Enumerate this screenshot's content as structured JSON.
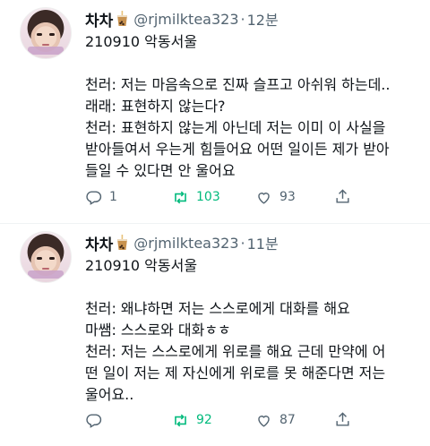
{
  "tweets": [
    {
      "name": "차차",
      "handle": "@rjmilktea323",
      "dot": "·",
      "time": "12분",
      "lines": [
        "210910 악동서울",
        "",
        "천러: 저는 마음속으로 진짜 슬프고 아쉬워 하는데..",
        "래래: 표현하지 않는다?",
        "천러: 표현하지 않는게 아닌데 저는 이미 이 사실을",
        "받아들여서 우는게 힘들어요 어떤 일이든 제가 받아",
        "들일 수 있다면 안 울어요"
      ],
      "replies": "1",
      "retweets": "103",
      "likes": "93"
    },
    {
      "name": "차차",
      "handle": "@rjmilktea323",
      "dot": "·",
      "time": "11분",
      "lines": [
        "210910 악동서울",
        "",
        "천러: 왜냐하면 저는 스스로에게 대화를 해요",
        "마쌤: 스스로와 대화ㅎㅎ",
        "천러: 저는 스스로에게 위로를 해요 근데 만약에 어",
        "떤 일이 저는 제 자신에게 위로를 못 해준다면 저는",
        "울어요.."
      ],
      "replies": "",
      "retweets": "92",
      "likes": "87"
    }
  ],
  "icons": {
    "avatar": "avatar",
    "badge": "bubble-tea-icon",
    "reply": "reply-icon",
    "retweet": "retweet-icon",
    "like": "heart-icon",
    "share": "share-icon"
  },
  "colors": {
    "text": "#0f1419",
    "muted": "#536471",
    "retweet_active": "#00ba7c",
    "divider": "#eff3f4"
  }
}
